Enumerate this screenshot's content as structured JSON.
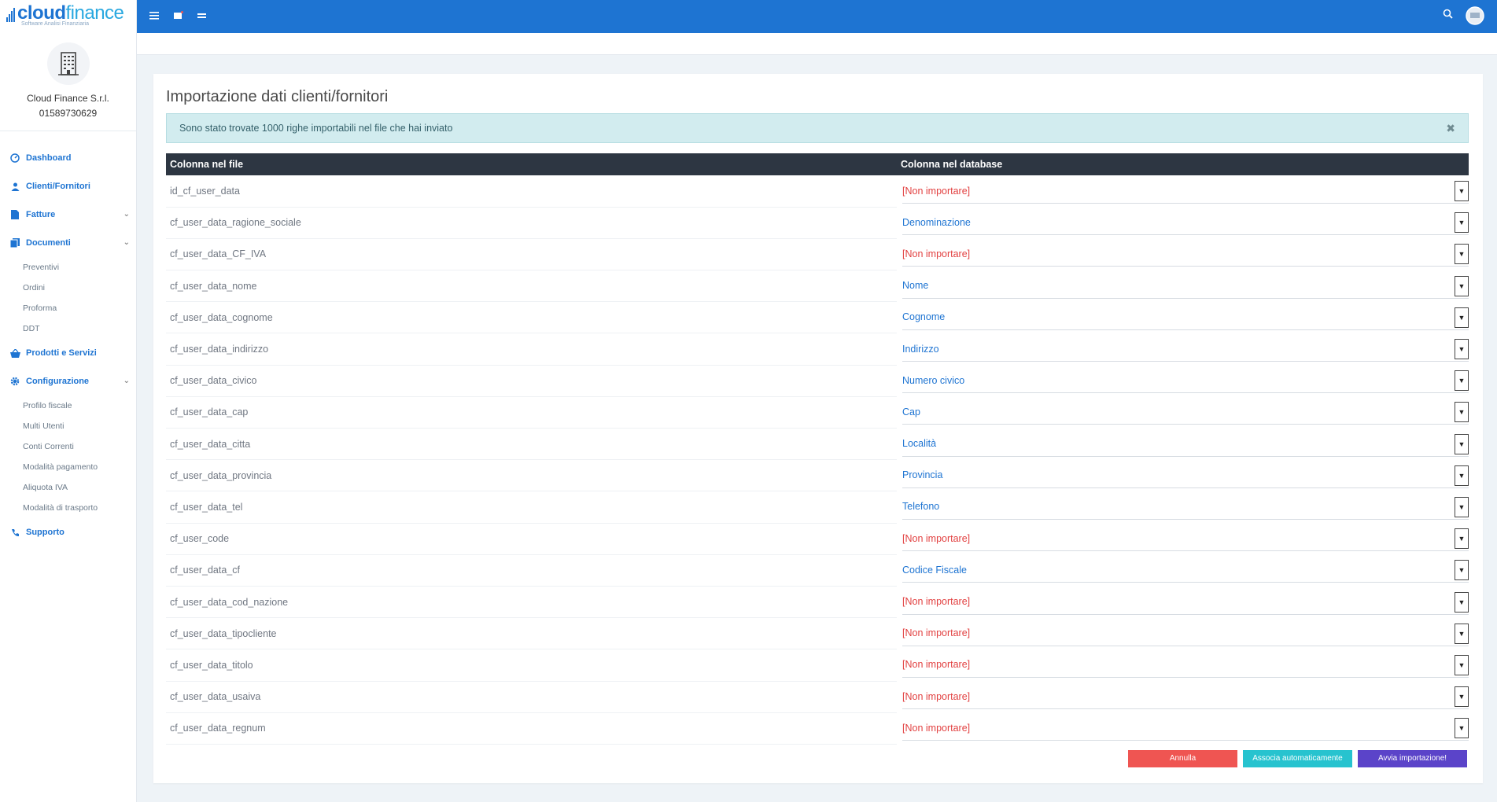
{
  "brand": {
    "name_bold": "cloud",
    "name_light": "finance",
    "tagline": "Software Analisi Finanziaria"
  },
  "company": {
    "name": "Cloud Finance S.r.l.",
    "vat": "01589730629"
  },
  "sidebar": {
    "items": [
      {
        "label": "Dashboard",
        "icon": "dashboard-icon"
      },
      {
        "label": "Clienti/Fornitori",
        "icon": "user-icon"
      },
      {
        "label": "Fatture",
        "icon": "file-icon",
        "expandable": true
      },
      {
        "label": "Documenti",
        "icon": "documents-icon",
        "expandable": true,
        "children": [
          "Preventivi",
          "Ordini",
          "Proforma",
          "DDT"
        ]
      },
      {
        "label": "Prodotti e Servizi",
        "icon": "basket-icon"
      },
      {
        "label": "Configurazione",
        "icon": "gear-icon",
        "expandable": true,
        "children": [
          "Profilo fiscale",
          "Multi Utenti",
          "Conti Correnti",
          "Modalità pagamento",
          "Aliquota IVA",
          "Modalità di trasporto"
        ]
      },
      {
        "label": "Supporto",
        "icon": "phone-icon"
      }
    ]
  },
  "page": {
    "title": "Importazione dati clienti/fornitori",
    "alert": "Sono stato trovate 1000 righe importabili nel file che hai inviato",
    "table": {
      "headers": [
        "Colonna nel file",
        "Colonna nel database"
      ],
      "rows": [
        {
          "file": "id_cf_user_data",
          "db": "[Non importare]",
          "status": "skip"
        },
        {
          "file": "cf_user_data_ragione_sociale",
          "db": "Denominazione",
          "status": "map"
        },
        {
          "file": "cf_user_data_CF_IVA",
          "db": "[Non importare]",
          "status": "skip"
        },
        {
          "file": "cf_user_data_nome",
          "db": "Nome",
          "status": "map"
        },
        {
          "file": "cf_user_data_cognome",
          "db": "Cognome",
          "status": "map"
        },
        {
          "file": "cf_user_data_indirizzo",
          "db": "Indirizzo",
          "status": "map"
        },
        {
          "file": "cf_user_data_civico",
          "db": "Numero civico",
          "status": "map"
        },
        {
          "file": "cf_user_data_cap",
          "db": "Cap",
          "status": "map"
        },
        {
          "file": "cf_user_data_citta",
          "db": "Località",
          "status": "map"
        },
        {
          "file": "cf_user_data_provincia",
          "db": "Provincia",
          "status": "map"
        },
        {
          "file": "cf_user_data_tel",
          "db": "Telefono",
          "status": "map"
        },
        {
          "file": "cf_user_code",
          "db": "[Non importare]",
          "status": "skip"
        },
        {
          "file": "cf_user_data_cf",
          "db": "Codice Fiscale",
          "status": "map"
        },
        {
          "file": "cf_user_data_cod_nazione",
          "db": "[Non importare]",
          "status": "skip"
        },
        {
          "file": "cf_user_data_tipocliente",
          "db": "[Non importare]",
          "status": "skip"
        },
        {
          "file": "cf_user_data_titolo",
          "db": "[Non importare]",
          "status": "skip"
        },
        {
          "file": "cf_user_data_usaiva",
          "db": "[Non importare]",
          "status": "skip"
        },
        {
          "file": "cf_user_data_regnum",
          "db": "[Non importare]",
          "status": "skip"
        }
      ]
    },
    "buttons": {
      "cancel": "Annulla",
      "auto": "Associa automaticamente",
      "start": "Avvia importazione!"
    }
  },
  "colors": {
    "primary": "#1e74d2",
    "skip": "#e24141",
    "cancel": "#ef5552",
    "auto": "#27c3cf",
    "start": "#5b44c9"
  }
}
